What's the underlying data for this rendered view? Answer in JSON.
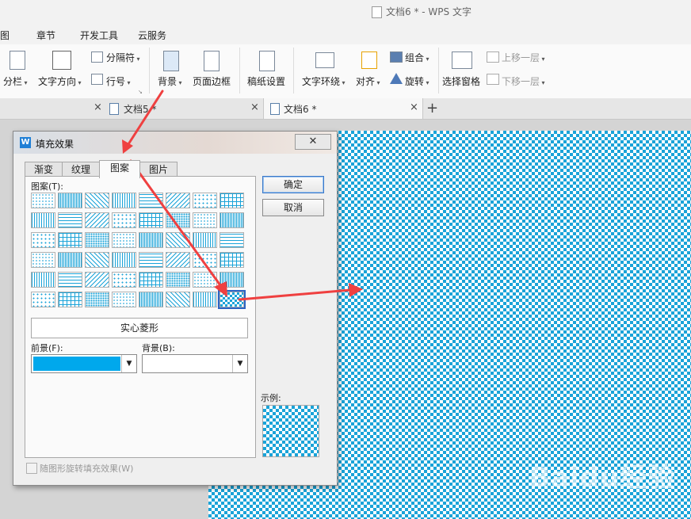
{
  "window": {
    "title": "文档6 * - WPS 文字"
  },
  "menu": [
    "图",
    "章节",
    "开发工具",
    "云服务"
  ],
  "ribbon": {
    "columns": "分栏",
    "text_direction": "文字方向",
    "separator": "分隔符",
    "line_number": "行号",
    "background": "背景",
    "page_border": "页面边框",
    "paper_settings": "稿纸设置",
    "text_wrap": "文字环绕",
    "align": "对齐",
    "group": "组合",
    "rotate": "旋转",
    "selection_pane": "选择窗格",
    "bring_forward": "上移一层",
    "send_backward": "下移一层"
  },
  "tabs": [
    {
      "label": "文档5 *"
    },
    {
      "label": "文档6 *"
    }
  ],
  "new_tab": "+",
  "dialog": {
    "title": "填充效果",
    "close": "✕",
    "tabs": [
      "渐变",
      "纹理",
      "图案",
      "图片"
    ],
    "active_tab": "图案",
    "pattern_label": "图案(T):",
    "selected_pattern_name": "实心菱形",
    "foreground_label": "前景(F):",
    "background_label": "背景(B):",
    "foreground_color": "#00a8ec",
    "background_color": "#ffffff",
    "ok": "确定",
    "cancel": "取消",
    "sample_label": "示例:",
    "rotate_checkbox": "随图形旋转填充效果(W)",
    "pattern_color": "#1aa3d8"
  },
  "watermark": "Baidu经验"
}
